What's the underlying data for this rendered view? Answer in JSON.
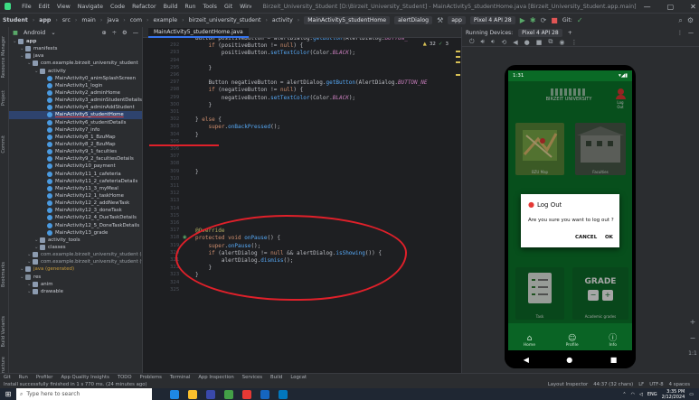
{
  "menubar": {
    "items": [
      "File",
      "Edit",
      "View",
      "Navigate",
      "Code",
      "Refactor",
      "Build",
      "Run",
      "Tools",
      "Git",
      "Window",
      "Help"
    ],
    "title": "Birzeit_University_Student [D:\\Birzeit_University_Student] - MainActivity5_studentHome.java [Birzeit_University_Student.app.main]"
  },
  "navbar": {
    "crumbs": [
      "Student",
      "app",
      "src",
      "main",
      "java",
      "com",
      "example",
      "birzeit_university_student",
      "activity"
    ],
    "file": "MainActivity5_studentHome",
    "method": "alertDialog",
    "module": "app",
    "device": "Pixel 4 API 28",
    "git": "Git:"
  },
  "project": {
    "view": "Android",
    "items": [
      {
        "label": "app",
        "type": "folder",
        "indent": 0,
        "bold": true
      },
      {
        "label": "manifests",
        "type": "folder",
        "indent": 1
      },
      {
        "label": "java",
        "type": "folder",
        "indent": 1
      },
      {
        "label": "com.example.birzeit_university_student",
        "type": "folder",
        "indent": 2
      },
      {
        "label": "activity",
        "type": "folder",
        "indent": 3
      },
      {
        "label": "MainActivity0_animSplashScreen",
        "type": "java",
        "indent": 4
      },
      {
        "label": "MainActivity1_login",
        "type": "java",
        "indent": 4
      },
      {
        "label": "MainActivity2_adminHome",
        "type": "java",
        "indent": 4
      },
      {
        "label": "MainActivity3_adminStudentDetails",
        "type": "java",
        "indent": 4
      },
      {
        "label": "MainActivity4_adminAddStudent",
        "type": "java",
        "indent": 4
      },
      {
        "label": "MainActivity5_studentHome",
        "type": "java",
        "indent": 4,
        "selected": true
      },
      {
        "label": "MainActivity6_studentDetails",
        "type": "java",
        "indent": 4
      },
      {
        "label": "MainActivity7_info",
        "type": "java",
        "indent": 4
      },
      {
        "label": "MainActivity8_1_BzuMap",
        "type": "java",
        "indent": 4
      },
      {
        "label": "MainActivity8_2_BzuMap",
        "type": "java",
        "indent": 4
      },
      {
        "label": "MainActivity9_1_faculties",
        "type": "java",
        "indent": 4
      },
      {
        "label": "MainActivity9_2_facultiesDetails",
        "type": "java",
        "indent": 4
      },
      {
        "label": "MainActivity10_payment",
        "type": "java",
        "indent": 4
      },
      {
        "label": "MainActivity11_1_cafeteria",
        "type": "java",
        "indent": 4
      },
      {
        "label": "MainActivity11_2_cafeteriaDetails",
        "type": "java",
        "indent": 4
      },
      {
        "label": "MainActivity11_3_myMeal",
        "type": "java",
        "indent": 4
      },
      {
        "label": "MainActivity12_1_taskHome",
        "type": "java",
        "indent": 4
      },
      {
        "label": "MainActivity12_2_addNewTask",
        "type": "java",
        "indent": 4
      },
      {
        "label": "MainActivity12_3_doneTask",
        "type": "java",
        "indent": 4
      },
      {
        "label": "MainActivity12_4_DueTaskDetails",
        "type": "java",
        "indent": 4
      },
      {
        "label": "MainActivity12_5_DoneTaskDetails",
        "type": "java",
        "indent": 4
      },
      {
        "label": "MainActivity13_grade",
        "type": "java",
        "indent": 4
      },
      {
        "label": "activity_tools",
        "type": "folder",
        "indent": 3
      },
      {
        "label": "classes",
        "type": "folder",
        "indent": 3
      },
      {
        "label": "com.example.birzeit_university_student (androidTest)",
        "type": "folder",
        "indent": 2,
        "dim": true
      },
      {
        "label": "com.example.birzeit_university_student (test)",
        "type": "folder",
        "indent": 2,
        "dim": true
      },
      {
        "label": "java (generated)",
        "type": "folder",
        "indent": 1,
        "gen": true
      },
      {
        "label": "res",
        "type": "res",
        "indent": 1
      },
      {
        "label": "anim",
        "type": "folder",
        "indent": 2
      },
      {
        "label": "drawable",
        "type": "folder",
        "indent": 2
      }
    ]
  },
  "editor": {
    "tab": "MainActivity5_studentHome.java",
    "lines": [
      {
        "n": "",
        "html": "Button positiveButton = alertDialog.getButton(AlertDialog.BUTTON_"
      },
      {
        "n": "292",
        "html": "    if (positiveButton != null) {"
      },
      {
        "n": "293",
        "html": "        positiveButton.setTextColor(Color.BLACK);"
      },
      {
        "n": "294",
        "html": ""
      },
      {
        "n": "295",
        "html": "    }"
      },
      {
        "n": "296",
        "html": ""
      },
      {
        "n": "297",
        "html": "    Button negativeButton = alertDialog.getButton(AlertDialog.BUTTON_NE"
      },
      {
        "n": "298",
        "html": "    if (negativeButton != null) {"
      },
      {
        "n": "299",
        "html": "        negativeButton.setTextColor(Color.BLACK);"
      },
      {
        "n": "300",
        "html": "    }"
      },
      {
        "n": "301",
        "html": ""
      },
      {
        "n": "302",
        "html": "} else {"
      },
      {
        "n": "303",
        "html": "    super.onBackPressed();"
      },
      {
        "n": "304",
        "html": "}"
      },
      {
        "n": "305",
        "html": ""
      },
      {
        "n": "306",
        "html": ""
      },
      {
        "n": "307",
        "html": ""
      },
      {
        "n": "308",
        "html": ""
      },
      {
        "n": "309",
        "html": "}"
      },
      {
        "n": "310",
        "html": ""
      },
      {
        "n": "311",
        "html": ""
      },
      {
        "n": "312",
        "html": ""
      },
      {
        "n": "313",
        "html": ""
      },
      {
        "n": "314",
        "html": ""
      },
      {
        "n": "315",
        "html": ""
      },
      {
        "n": "316",
        "html": ""
      },
      {
        "n": "317",
        "html": "@Override"
      },
      {
        "n": "318",
        "html": "protected void onPause() {"
      },
      {
        "n": "319",
        "html": "    super.onPause();"
      },
      {
        "n": "320",
        "html": "    if (alertDialog != null && alertDialog.isShowing()) {"
      },
      {
        "n": "321",
        "html": "        alertDialog.dismiss();"
      },
      {
        "n": "322",
        "html": "    }"
      },
      {
        "n": "323",
        "html": "}"
      },
      {
        "n": "324",
        "html": ""
      },
      {
        "n": "325",
        "html": ""
      }
    ],
    "problems": "32",
    "warnings": "3"
  },
  "running": {
    "label": "Running Devices:",
    "device": "Pixel 4 API 28"
  },
  "phone": {
    "time": "1:31",
    "logo": "BIRZEIT UNIVERSITY",
    "logout_label": "Log Out",
    "tile1": "BZU Map",
    "tile2": "Faculties",
    "tile3": "Task",
    "tile4": "Academic grades",
    "dialog": {
      "title": "Log Out",
      "message": "Are you sure you want to log out ?",
      "cancel": "CANCEL",
      "ok": "OK"
    },
    "grade": "GRADE",
    "nav": [
      "Home",
      "Profile",
      "Info"
    ]
  },
  "toolwindows": [
    "Git",
    "Run",
    "Profiler",
    "App Quality Insights",
    "TODO",
    "Problems",
    "Terminal",
    "App Inspection",
    "Services",
    "Build",
    "Logcat"
  ],
  "status": {
    "message": "Install successfully finished in 1 s 770 ms. (24 minutes ago)",
    "pos": "44:37 (32 chars)",
    "eol": "LF",
    "enc": "UTF-8",
    "indent": "4 spaces",
    "inspector": "Layout Inspector"
  },
  "taskbar": {
    "search": "Type here to search",
    "time": "3:35 PM",
    "date": "2/12/2024",
    "lang": "ENG"
  }
}
